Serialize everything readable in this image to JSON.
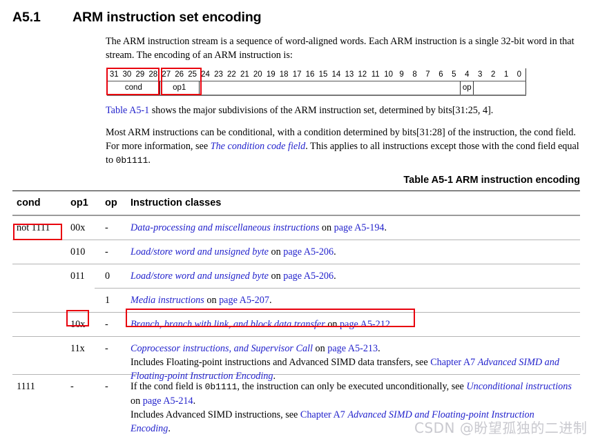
{
  "heading": {
    "number": "A5.1",
    "title": "ARM instruction set encoding"
  },
  "paragraphs": {
    "intro": "The ARM instruction stream is a sequence of word-aligned words. Each ARM instruction is a single 32-bit word in that stream. The encoding of an ARM instruction is:",
    "table_ref_link": "Table A5-1",
    "table_ref_rest": " shows the major subdivisions of the ARM instruction set, determined by bits[31:25, 4].",
    "cond_part1": "Most ARM instructions can be conditional, with a condition determined by bits[31:28] of the instruction, the cond field. For more information, see ",
    "cond_link": "The condition code field",
    "cond_part2": ". This applies to all instructions except those with the cond field equal to ",
    "cond_mono": "0b1111",
    "cond_part3": "."
  },
  "bit_diagram": {
    "bit_labels": [
      "31",
      "30",
      "29",
      "28",
      "27",
      "26",
      "25",
      "24",
      "23",
      "22",
      "21",
      "20",
      "19",
      "18",
      "17",
      "16",
      "15",
      "14",
      "13",
      "12",
      "11",
      "10",
      "9",
      "8",
      "7",
      "6",
      "5",
      "4",
      "3",
      "2",
      "1",
      "0"
    ],
    "fields": [
      {
        "name": "cond",
        "span": 4,
        "bits": "31:28"
      },
      {
        "name": "op1",
        "span": 3,
        "bits": "27:25"
      },
      {
        "name": "",
        "span": 20,
        "bits": "24:5"
      },
      {
        "name": "op",
        "span": 1,
        "bits": "4"
      },
      {
        "name": "",
        "span": 4,
        "bits": "3:0"
      }
    ],
    "highlight_fields": [
      "cond",
      "op1"
    ]
  },
  "table": {
    "caption": "Table A5-1 ARM instruction encoding",
    "columns": [
      "cond",
      "op1",
      "op",
      "Instruction classes"
    ],
    "rows": [
      {
        "cond": "not 1111",
        "op1": "00x",
        "op": "-",
        "lines": [
          [
            {
              "t": "Data-processing and miscellaneous instructions",
              "s": "link-italic"
            },
            {
              "t": " on ",
              "s": "plain"
            },
            {
              "t": "page A5-194",
              "s": "link"
            },
            {
              "t": ".",
              "s": "plain"
            }
          ]
        ],
        "cond_highlight": true,
        "divider": "full"
      },
      {
        "cond": "",
        "op1": "010",
        "op": "-",
        "lines": [
          [
            {
              "t": "Load/store word and unsigned byte",
              "s": "link-italic"
            },
            {
              "t": " on ",
              "s": "plain"
            },
            {
              "t": "page A5-206",
              "s": "link"
            },
            {
              "t": ".",
              "s": "plain"
            }
          ]
        ],
        "divider": "full"
      },
      {
        "cond": "",
        "op1": "011",
        "op": "0",
        "lines": [
          [
            {
              "t": "Load/store word and unsigned byte",
              "s": "link-italic"
            },
            {
              "t": " on ",
              "s": "plain"
            },
            {
              "t": "page A5-206",
              "s": "link"
            },
            {
              "t": ".",
              "s": "plain"
            }
          ]
        ],
        "divider": "sub"
      },
      {
        "cond": "",
        "op1": "",
        "op": "1",
        "lines": [
          [
            {
              "t": "Media instructions",
              "s": "link-italic"
            },
            {
              "t": " on ",
              "s": "plain"
            },
            {
              "t": "page A5-207",
              "s": "link"
            },
            {
              "t": ".",
              "s": "plain"
            }
          ]
        ],
        "divider": "full"
      },
      {
        "cond": "",
        "op1": "10x",
        "op": "-",
        "lines": [
          [
            {
              "t": "Branch, branch with link, and block data transfer",
              "s": "link-italic"
            },
            {
              "t": " on ",
              "s": "plain"
            },
            {
              "t": "page A5-212",
              "s": "link"
            },
            {
              "t": ".",
              "s": "plain"
            }
          ]
        ],
        "op1_highlight": true,
        "classes_highlight": true,
        "divider": "full"
      },
      {
        "cond": "",
        "op1": "11x",
        "op": "-",
        "lines": [
          [
            {
              "t": "Coprocessor instructions, and Supervisor Call",
              "s": "link-italic"
            },
            {
              "t": " on ",
              "s": "plain"
            },
            {
              "t": "page A5-213",
              "s": "link"
            },
            {
              "t": ".",
              "s": "plain"
            }
          ],
          [
            {
              "t": "Includes Floating-point instructions and Advanced SIMD data transfers, see ",
              "s": "plain"
            },
            {
              "t": "Chapter A7",
              "s": "link"
            },
            {
              "t": " ",
              "s": "plain"
            },
            {
              "t": "Advanced SIMD and Floating-point Instruction Encoding",
              "s": "link-italic"
            },
            {
              "t": ".",
              "s": "plain"
            }
          ]
        ],
        "divider": "full"
      },
      {
        "cond": "1111",
        "op1": "-",
        "op": "-",
        "lines": [
          [
            {
              "t": "If the cond field is ",
              "s": "plain"
            },
            {
              "t": "0b1111",
              "s": "mono"
            },
            {
              "t": ", the instruction can only be executed unconditionally, see ",
              "s": "plain"
            },
            {
              "t": "Unconditional instructions",
              "s": "link-italic"
            },
            {
              "t": " on ",
              "s": "plain"
            },
            {
              "t": "page A5-214",
              "s": "link"
            },
            {
              "t": ".",
              "s": "plain"
            }
          ],
          [
            {
              "t": "Includes Advanced SIMD instructions, see ",
              "s": "plain"
            },
            {
              "t": "Chapter A7",
              "s": "link"
            },
            {
              "t": " ",
              "s": "plain"
            },
            {
              "t": "Advanced SIMD and Floating-point Instruction Encoding",
              "s": "link-italic"
            },
            {
              "t": ".",
              "s": "plain"
            }
          ]
        ],
        "divider": "none"
      }
    ]
  },
  "watermark": {
    "text": "CSDN @盼望孤独的二进制"
  },
  "colors": {
    "link": "#2222cc",
    "highlight": "#e8000d",
    "text": "#000000",
    "rule_dark": "#1a1a1a",
    "rule_light": "#b4b4b4",
    "watermark": "#c9c9cf"
  }
}
